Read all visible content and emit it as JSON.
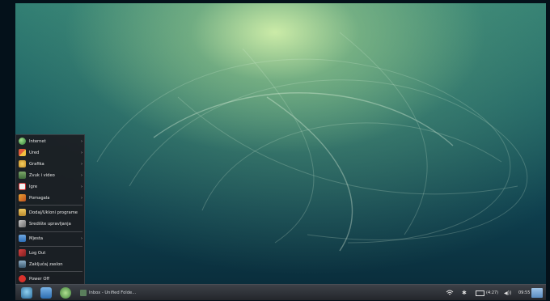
{
  "menu": {
    "items": [
      {
        "label": "Internet",
        "icon": "globe-icon",
        "submenu": true
      },
      {
        "label": "Ured",
        "icon": "office-icon",
        "submenu": true
      },
      {
        "label": "Grafika",
        "icon": "graphics-icon",
        "submenu": true
      },
      {
        "label": "Zvuk i video",
        "icon": "media-icon",
        "submenu": true
      },
      {
        "label": "Igre",
        "icon": "games-icon",
        "submenu": true
      },
      {
        "label": "Pomagala",
        "icon": "accessories-icon",
        "submenu": true
      }
    ],
    "system": [
      {
        "label": "Dodaj/Ukloni programe",
        "icon": "package-icon"
      },
      {
        "label": "Središte upravljanja",
        "icon": "tools-icon"
      }
    ],
    "places": {
      "label": "Mjesta",
      "icon": "folder-icon",
      "submenu": true
    },
    "session": [
      {
        "label": "Log Out",
        "icon": "logout-icon"
      },
      {
        "label": "Zaključaj zaslon",
        "icon": "lock-screen-icon"
      },
      {
        "label": "Power Off",
        "icon": "power-icon"
      }
    ],
    "arrow": "›"
  },
  "taskbar": {
    "task_label": "Inbox - Unified Folde...",
    "battery": "(4:27)",
    "clock": "09:55"
  }
}
